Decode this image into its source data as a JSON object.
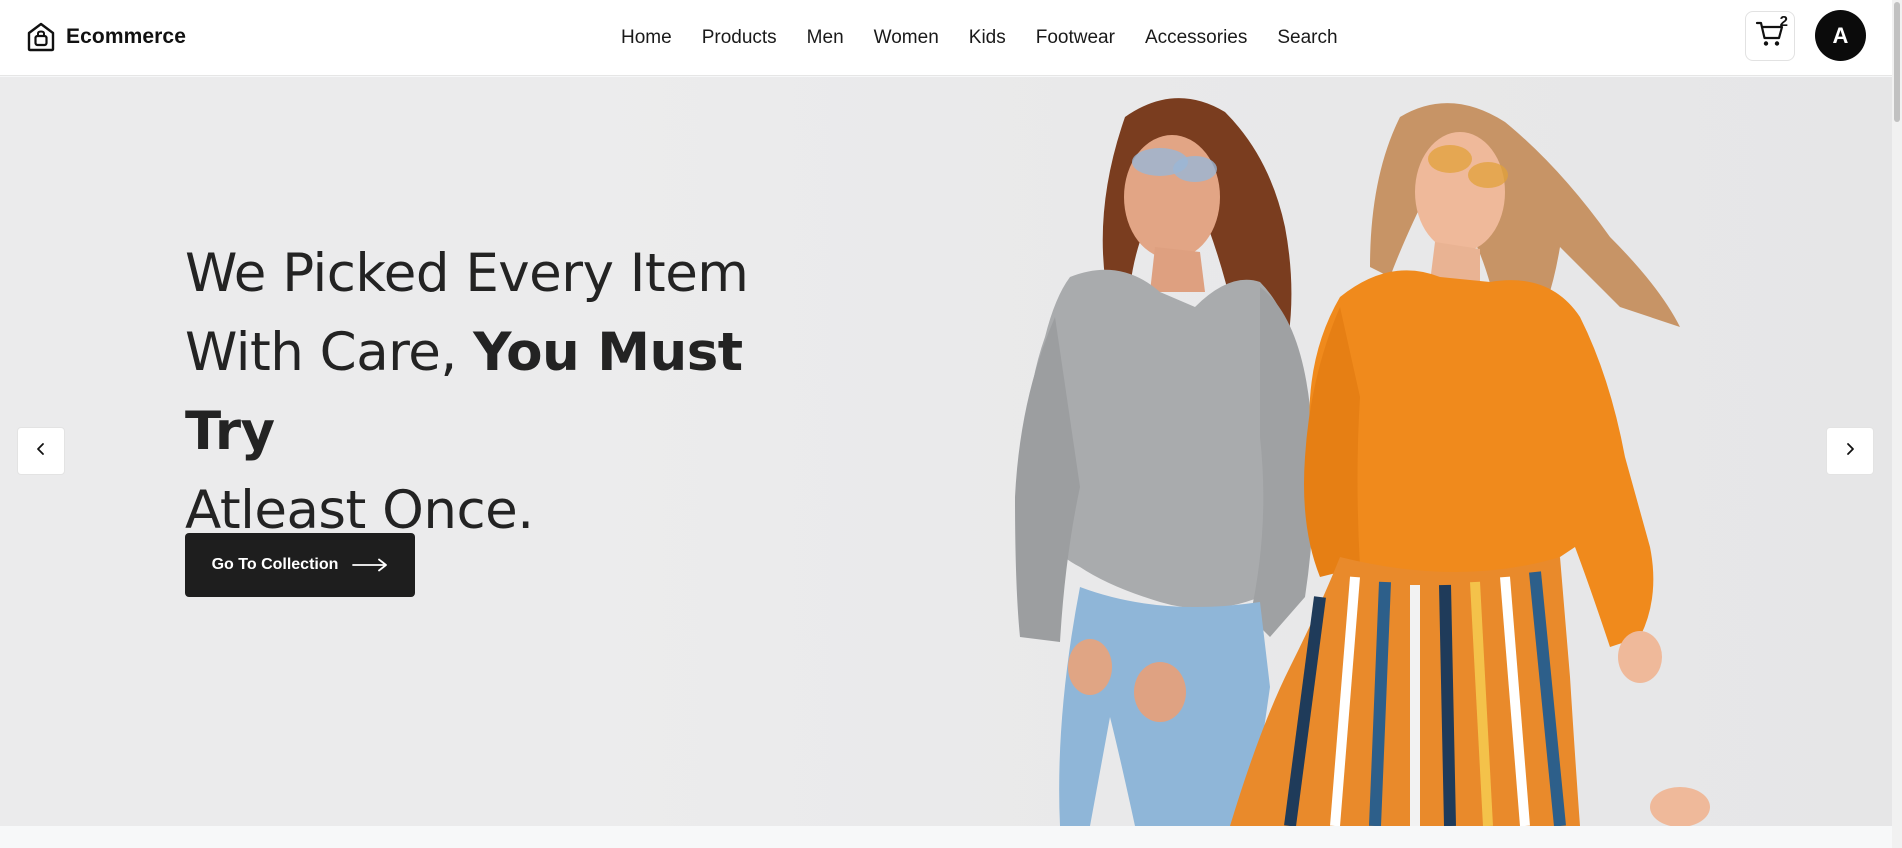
{
  "header": {
    "brand_name": "Ecommerce",
    "brand_icon": "shopping-bag-icon",
    "nav": [
      {
        "label": "Home"
      },
      {
        "label": "Products"
      },
      {
        "label": "Men"
      },
      {
        "label": "Women"
      },
      {
        "label": "Kids"
      },
      {
        "label": "Footwear"
      },
      {
        "label": "Accessories"
      },
      {
        "label": "Search"
      }
    ],
    "cart": {
      "icon": "cart-icon",
      "count": "2"
    },
    "avatar_initial": "A"
  },
  "hero": {
    "headline_line1": "We Picked Every Item",
    "headline_line2_regular": "With Care, ",
    "headline_line2_bold": "You Must Try",
    "headline_line3": "Atleast Once.",
    "cta_label": "Go To Collection",
    "cta_icon": "arrow-right-icon",
    "prev_icon": "chevron-left-icon",
    "next_icon": "chevron-right-icon",
    "image": "two-women-laughing-photo"
  },
  "colors": {
    "header_bg": "#ffffff",
    "hero_bg": "#ebebec",
    "cta_bg": "#1e1e1e",
    "avatar_bg": "#0b0b0b",
    "text_dark": "#232323",
    "sweater_grey": "#a9abad",
    "sweater_orange": "#f08a1c"
  }
}
